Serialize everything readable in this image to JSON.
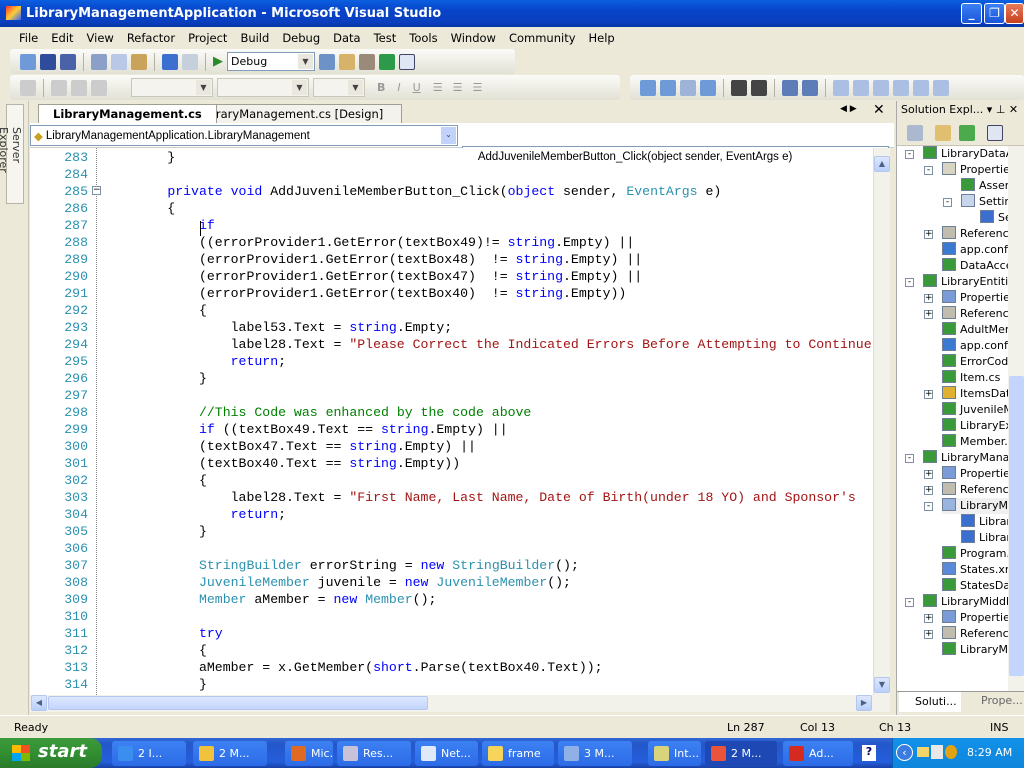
{
  "window": {
    "title": "LibraryManagementApplication - Microsoft Visual Studio"
  },
  "menu": [
    "File",
    "Edit",
    "View",
    "Refactor",
    "Project",
    "Build",
    "Debug",
    "Data",
    "Test",
    "Tools",
    "Window",
    "Community",
    "Help"
  ],
  "toolbar": {
    "config": "Debug"
  },
  "server_explorer": "Server Explorer",
  "tabs": [
    {
      "label": "LibraryManagement.cs",
      "active": true
    },
    {
      "label": "LibraryManagement.cs [Design]",
      "active": false
    }
  ],
  "nav": {
    "type_combo": "LibraryManagementApplication.LibraryManagement",
    "member_combo": "AddJuvenileMemberButton_Click(object sender, EventArgs e)"
  },
  "colors": {
    "keyword": "#0000ff",
    "type": "#2b91af",
    "string": "#a31515",
    "comment": "#008000"
  },
  "code": {
    "first_line": 283,
    "lines": [
      [
        [
          "p",
          "        }"
        ]
      ],
      [],
      [
        [
          "p",
          "        "
        ],
        [
          "k",
          "private"
        ],
        [
          "p",
          " "
        ],
        [
          "k",
          "void"
        ],
        [
          "p",
          " AddJuvenileMemberButton_Click("
        ],
        [
          "k",
          "object"
        ],
        [
          "p",
          " sender, "
        ],
        [
          "t",
          "EventArgs"
        ],
        [
          "p",
          " e)"
        ]
      ],
      [
        [
          "p",
          "        {"
        ]
      ],
      [
        [
          "p",
          "            "
        ],
        [
          "k",
          "if"
        ]
      ],
      [
        [
          "p",
          "            ((errorProvider1.GetError(textBox49)!= "
        ],
        [
          "k",
          "string"
        ],
        [
          "p",
          ".Empty) ||"
        ]
      ],
      [
        [
          "p",
          "            (errorProvider1.GetError(textBox48)  != "
        ],
        [
          "k",
          "string"
        ],
        [
          "p",
          ".Empty) ||"
        ]
      ],
      [
        [
          "p",
          "            (errorProvider1.GetError(textBox47)  != "
        ],
        [
          "k",
          "string"
        ],
        [
          "p",
          ".Empty) ||"
        ]
      ],
      [
        [
          "p",
          "            (errorProvider1.GetError(textBox40)  != "
        ],
        [
          "k",
          "string"
        ],
        [
          "p",
          ".Empty))"
        ]
      ],
      [
        [
          "p",
          "            {"
        ]
      ],
      [
        [
          "p",
          "                label53.Text = "
        ],
        [
          "k",
          "string"
        ],
        [
          "p",
          ".Empty;"
        ]
      ],
      [
        [
          "p",
          "                label28.Text = "
        ],
        [
          "s",
          "\"Please Correct the Indicated Errors Before Attempting to Continue"
        ]
      ],
      [
        [
          "p",
          "                "
        ],
        [
          "k",
          "return"
        ],
        [
          "p",
          ";"
        ]
      ],
      [
        [
          "p",
          "            }"
        ]
      ],
      [],
      [
        [
          "p",
          "            "
        ],
        [
          "c",
          "//This Code was enhanced by the code above"
        ]
      ],
      [
        [
          "p",
          "            "
        ],
        [
          "k",
          "if"
        ],
        [
          "p",
          " ((textBox49.Text == "
        ],
        [
          "k",
          "string"
        ],
        [
          "p",
          ".Empty) ||"
        ]
      ],
      [
        [
          "p",
          "            (textBox47.Text == "
        ],
        [
          "k",
          "string"
        ],
        [
          "p",
          ".Empty) ||"
        ]
      ],
      [
        [
          "p",
          "            (textBox40.Text == "
        ],
        [
          "k",
          "string"
        ],
        [
          "p",
          ".Empty))"
        ]
      ],
      [
        [
          "p",
          "            {"
        ]
      ],
      [
        [
          "p",
          "                label28.Text = "
        ],
        [
          "s",
          "\"First Name, Last Name, Date of Birth(under 18 YO) and Sponsor's"
        ]
      ],
      [
        [
          "p",
          "                "
        ],
        [
          "k",
          "return"
        ],
        [
          "p",
          ";"
        ]
      ],
      [
        [
          "p",
          "            }"
        ]
      ],
      [],
      [
        [
          "p",
          "            "
        ],
        [
          "t",
          "StringBuilder"
        ],
        [
          "p",
          " errorString = "
        ],
        [
          "k",
          "new"
        ],
        [
          "p",
          " "
        ],
        [
          "t",
          "StringBuilder"
        ],
        [
          "p",
          "();"
        ]
      ],
      [
        [
          "p",
          "            "
        ],
        [
          "t",
          "JuvenileMember"
        ],
        [
          "p",
          " juvenile = "
        ],
        [
          "k",
          "new"
        ],
        [
          "p",
          " "
        ],
        [
          "t",
          "JuvenileMember"
        ],
        [
          "p",
          "();"
        ]
      ],
      [
        [
          "p",
          "            "
        ],
        [
          "t",
          "Member"
        ],
        [
          "p",
          " aMember = "
        ],
        [
          "k",
          "new"
        ],
        [
          "p",
          " "
        ],
        [
          "t",
          "Member"
        ],
        [
          "p",
          "();"
        ]
      ],
      [],
      [
        [
          "p",
          "            "
        ],
        [
          "k",
          "try"
        ]
      ],
      [
        [
          "p",
          "            {"
        ]
      ],
      [
        [
          "p",
          "            aMember = x.GetMember("
        ],
        [
          "k",
          "short"
        ],
        [
          "p",
          ".Parse(textBox40.Text));"
        ]
      ],
      [
        [
          "p",
          "            }"
        ]
      ]
    ]
  },
  "solution_explorer": {
    "title": "Solution Expl...",
    "tabs": [
      "Soluti...",
      "Prope..."
    ],
    "items": [
      {
        "level": 0,
        "exp": "-",
        "icon": "csproj",
        "label": "LibraryDataAccess"
      },
      {
        "level": 1,
        "exp": "-",
        "icon": "folder",
        "label": "Properties"
      },
      {
        "level": 2,
        "exp": "",
        "icon": "cs",
        "label": "AssemblyInfo.cs"
      },
      {
        "level": 2,
        "exp": "-",
        "icon": "settings",
        "label": "Settings.settings"
      },
      {
        "level": 3,
        "exp": "",
        "icon": "designer",
        "label": "Settings.Designer.cs"
      },
      {
        "level": 1,
        "exp": "+",
        "icon": "references",
        "label": "References"
      },
      {
        "level": 1,
        "exp": "",
        "icon": "config",
        "label": "app.config"
      },
      {
        "level": 1,
        "exp": "",
        "icon": "cs",
        "label": "DataAccess.cs"
      },
      {
        "level": 0,
        "exp": "-",
        "icon": "csproj",
        "label": "LibraryEntities"
      },
      {
        "level": 1,
        "exp": "+",
        "icon": "properties",
        "label": "Properties"
      },
      {
        "level": 1,
        "exp": "+",
        "icon": "references",
        "label": "References"
      },
      {
        "level": 1,
        "exp": "",
        "icon": "cs",
        "label": "AdultMember.cs"
      },
      {
        "level": 1,
        "exp": "",
        "icon": "config",
        "label": "app.config"
      },
      {
        "level": 1,
        "exp": "",
        "icon": "cs",
        "label": "ErrorCode.cs"
      },
      {
        "level": 1,
        "exp": "",
        "icon": "cs",
        "label": "Item.cs"
      },
      {
        "level": 1,
        "exp": "+",
        "icon": "dataset",
        "label": "ItemsDataSet.xsd"
      },
      {
        "level": 1,
        "exp": "",
        "icon": "cs",
        "label": "JuvenileMember.cs"
      },
      {
        "level": 1,
        "exp": "",
        "icon": "cs",
        "label": "LibraryException.cs"
      },
      {
        "level": 1,
        "exp": "",
        "icon": "cs",
        "label": "Member.cs"
      },
      {
        "level": 0,
        "exp": "-",
        "icon": "csproj",
        "label": "LibraryManagementApplication"
      },
      {
        "level": 1,
        "exp": "+",
        "icon": "properties",
        "label": "Properties"
      },
      {
        "level": 1,
        "exp": "+",
        "icon": "references",
        "label": "References"
      },
      {
        "level": 1,
        "exp": "-",
        "icon": "form",
        "label": "LibraryManagement.cs"
      },
      {
        "level": 2,
        "exp": "",
        "icon": "designer",
        "label": "LibraryManagement.Designer.cs"
      },
      {
        "level": 2,
        "exp": "",
        "icon": "designer",
        "label": "LibraryManagement.resx"
      },
      {
        "level": 1,
        "exp": "",
        "icon": "cs",
        "label": "Program.cs"
      },
      {
        "level": 1,
        "exp": "",
        "icon": "xml",
        "label": "States.xml"
      },
      {
        "level": 1,
        "exp": "",
        "icon": "cs",
        "label": "StatesDal.cs"
      },
      {
        "level": 0,
        "exp": "-",
        "icon": "csproj",
        "label": "LibraryMiddleTier"
      },
      {
        "level": 1,
        "exp": "+",
        "icon": "properties",
        "label": "Properties"
      },
      {
        "level": 1,
        "exp": "+",
        "icon": "references",
        "label": "References"
      },
      {
        "level": 1,
        "exp": "",
        "icon": "cs",
        "label": "LibraryMiddleTier.cs"
      }
    ]
  },
  "status": {
    "text": "Ready",
    "ln": "Ln 287",
    "col": "Col 13",
    "ch": "Ch 13",
    "mode": "INS"
  },
  "taskbar": {
    "start": "start",
    "clock": "8:29 AM",
    "items": [
      {
        "label": "2 I...",
        "icon": "ie",
        "color": "#3a8ef0"
      },
      {
        "label": "2 M...",
        "icon": "outlook",
        "color": "#f3c23c"
      },
      {
        "label": "Mic...",
        "icon": "app",
        "color": "#e06a22"
      },
      {
        "label": "Res...",
        "icon": "window",
        "color": "#c7c2d8"
      },
      {
        "label": "Net...",
        "icon": "word",
        "color": "#dfe9f8"
      },
      {
        "label": "frame",
        "icon": "folder",
        "color": "#f7d45a"
      },
      {
        "label": "3 M...",
        "icon": "app",
        "color": "#8fb1e8"
      },
      {
        "label": "Int...",
        "icon": "app",
        "color": "#d9d37b"
      },
      {
        "label": "2 M...",
        "icon": "visual-studio",
        "color": "#e9543b",
        "active": true
      },
      {
        "label": "Ad...",
        "icon": "acrobat",
        "color": "#d52b1e"
      }
    ]
  }
}
